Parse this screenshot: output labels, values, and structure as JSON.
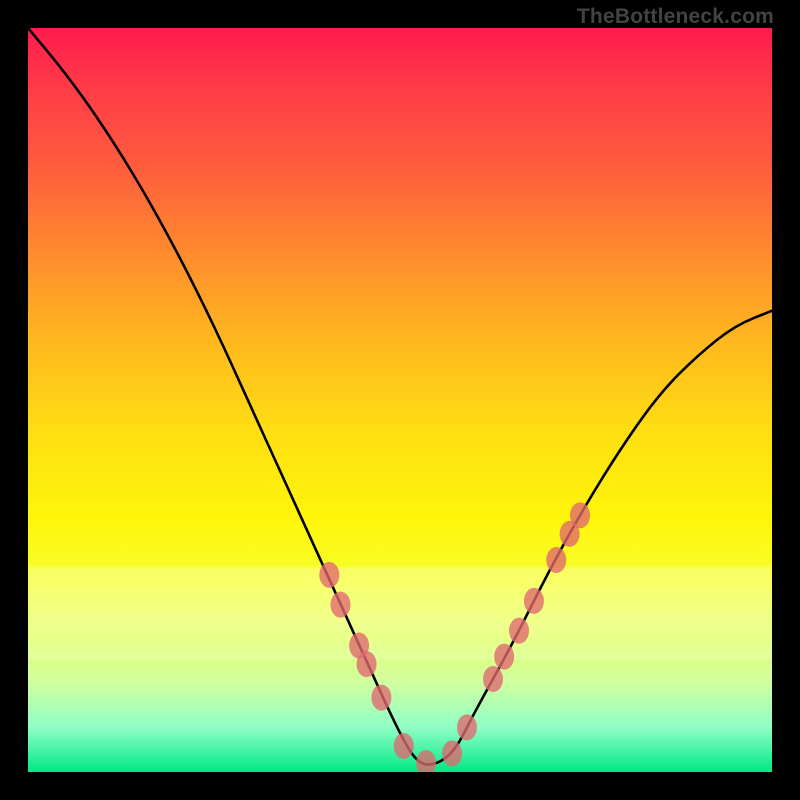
{
  "watermark": "TheBottleneck.com",
  "chart_data": {
    "type": "line",
    "title": "",
    "xlabel": "",
    "ylabel": "",
    "xlim": [
      0,
      1
    ],
    "ylim": [
      0,
      1
    ],
    "series": [
      {
        "name": "bottleneck-curve",
        "x": [
          0.0,
          0.05,
          0.1,
          0.15,
          0.2,
          0.25,
          0.3,
          0.35,
          0.4,
          0.45,
          0.5,
          0.525,
          0.55,
          0.575,
          0.6,
          0.65,
          0.7,
          0.75,
          0.8,
          0.85,
          0.9,
          0.95,
          1.0
        ],
        "y": [
          1.0,
          0.94,
          0.87,
          0.79,
          0.7,
          0.6,
          0.49,
          0.38,
          0.27,
          0.16,
          0.05,
          0.01,
          0.01,
          0.03,
          0.08,
          0.17,
          0.27,
          0.36,
          0.44,
          0.51,
          0.56,
          0.6,
          0.62
        ]
      }
    ],
    "markers": {
      "name": "highlight-dots",
      "x": [
        0.405,
        0.42,
        0.445,
        0.455,
        0.475,
        0.505,
        0.535,
        0.57,
        0.59,
        0.625,
        0.64,
        0.66,
        0.68,
        0.71,
        0.728,
        0.742
      ],
      "y": [
        0.265,
        0.225,
        0.17,
        0.145,
        0.1,
        0.035,
        0.012,
        0.025,
        0.06,
        0.125,
        0.155,
        0.19,
        0.23,
        0.285,
        0.32,
        0.345
      ]
    },
    "colors": {
      "curve": "#000000",
      "markers": "#e0686f",
      "gradient_top": "#ff1a4d",
      "gradient_mid": "#ffe012",
      "gradient_bottom": "#00e884"
    }
  }
}
